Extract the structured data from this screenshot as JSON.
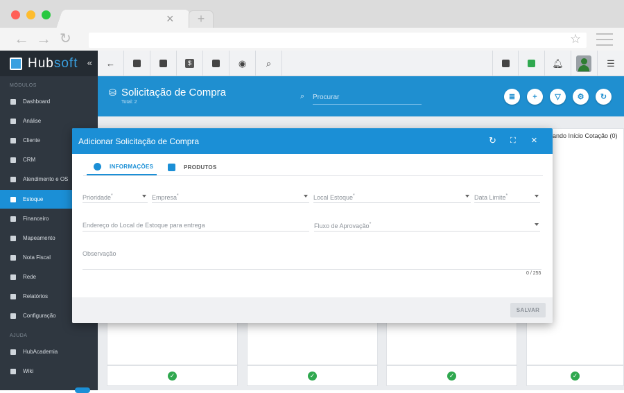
{
  "app": {
    "logo_main": "Hub",
    "logo_accent": "soft",
    "collapse_icon": "«"
  },
  "sidebar": {
    "section_modules": "MÓDULOS",
    "section_help": "AJUDA",
    "items": [
      {
        "label": "Dashboard",
        "icon": "dashboard-icon"
      },
      {
        "label": "Análise",
        "icon": "chart-pie-icon"
      },
      {
        "label": "Cliente",
        "icon": "contact-card-icon"
      },
      {
        "label": "CRM",
        "icon": "crm-icon"
      },
      {
        "label": "Atendimento e OS",
        "icon": "calendar-clock-icon"
      },
      {
        "label": "Estoque",
        "icon": "box-icon",
        "active": true
      },
      {
        "label": "Financeiro",
        "icon": "money-icon"
      },
      {
        "label": "Mapeamento",
        "icon": "map-pin-icon"
      },
      {
        "label": "Nota Fiscal",
        "icon": "invoice-icon"
      },
      {
        "label": "Rede",
        "icon": "network-icon"
      },
      {
        "label": "Relatórios",
        "icon": "report-icon"
      },
      {
        "label": "Configuração",
        "icon": "gear-icon"
      }
    ],
    "help_items": [
      {
        "label": "HubAcademia",
        "icon": "play-icon"
      },
      {
        "label": "Wiki",
        "icon": "wiki-icon"
      }
    ]
  },
  "banner": {
    "title": "Solicitação de Compra",
    "subtitle": "Total: 2",
    "search_placeholder": "Procurar"
  },
  "board": {
    "column_header_partial": "ando Início Cotação (0)"
  },
  "modal": {
    "title": "Adicionar Solicitação de Compra",
    "tabs": [
      "INFORMAÇÕES",
      "PRODUTOS"
    ],
    "fields": {
      "prioridade": "Prioridade",
      "empresa": "Empresa",
      "local_estoque": "Local Estoque",
      "data_limite": "Data Limite",
      "endereco": "Endereço do Local de Estoque para entrega",
      "fluxo": "Fluxo de Aprovação",
      "observacao": "Observação"
    },
    "required_mark": "*",
    "counter": "0 / 255",
    "save_label": "SALVAR"
  },
  "colors": {
    "accent": "#1b8fd6",
    "sidebar": "#2f3740",
    "success": "#2fa84f"
  }
}
